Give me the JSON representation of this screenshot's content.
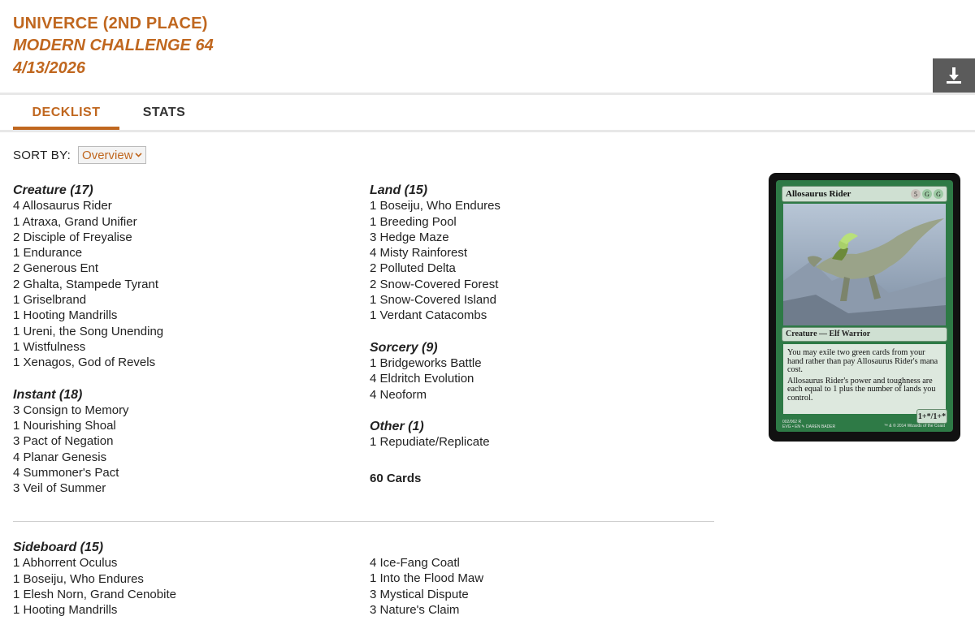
{
  "header": {
    "player": "UNIVERCE (2ND PLACE)",
    "event": "MODERN CHALLENGE 64",
    "date": "4/13/2026"
  },
  "tabs": [
    {
      "label": "DECKLIST",
      "active": true
    },
    {
      "label": "STATS",
      "active": false
    }
  ],
  "sort": {
    "label": "SORT BY:",
    "selected": "Overview"
  },
  "left_groups": [
    {
      "title": "Creature (17)",
      "cards": [
        "4 Allosaurus Rider",
        "1 Atraxa, Grand Unifier",
        "2 Disciple of Freyalise",
        "1 Endurance",
        "2 Generous Ent",
        "2 Ghalta, Stampede Tyrant",
        "1 Griselbrand",
        "1 Hooting Mandrills",
        "1 Ureni, the Song Unending",
        "1 Wistfulness",
        "1 Xenagos, God of Revels"
      ]
    },
    {
      "title": "Instant (18)",
      "cards": [
        "3 Consign to Memory",
        "1 Nourishing Shoal",
        "3 Pact of Negation",
        "4 Planar Genesis",
        "4 Summoner's Pact",
        "3 Veil of Summer"
      ]
    }
  ],
  "right_groups": [
    {
      "title": "Land (15)",
      "cards": [
        "1 Boseiju, Who Endures",
        "1 Breeding Pool",
        "3 Hedge Maze",
        "4 Misty Rainforest",
        "2 Polluted Delta",
        "2 Snow-Covered Forest",
        "1 Snow-Covered Island",
        "1 Verdant Catacombs"
      ]
    },
    {
      "title": "Sorcery (9)",
      "cards": [
        "1 Bridgeworks Battle",
        "4 Eldritch Evolution",
        "4 Neoform"
      ]
    },
    {
      "title": "Other (1)",
      "cards": [
        "1 Repudiate/Replicate"
      ]
    }
  ],
  "total": "60 Cards",
  "sideboard": {
    "title": "Sideboard (15)",
    "left": [
      "1 Abhorrent Oculus",
      "1 Boseiju, Who Endures",
      "1 Elesh Norn, Grand Cenobite",
      "1 Hooting Mandrills"
    ],
    "right": [
      "4 Ice-Fang Coatl",
      "1 Into the Flood Maw",
      "3 Mystical Dispute",
      "3 Nature's Claim"
    ]
  },
  "card_preview": {
    "name": "Allosaurus Rider",
    "mana": [
      "5",
      "G",
      "G"
    ],
    "type": "Creature — Elf Warrior",
    "text": [
      "You may exile two green cards from your hand rather than pay Allosaurus Rider's mana cost.",
      "Allosaurus Rider's power and toughness are each equal to 1 plus the number of lands you control."
    ],
    "pt": "1+*/1+*",
    "footer": "002/062 R",
    "footer2": "EVG • EN ✎ DAREN BADER",
    "copyright": "™ & © 2014 Wizards of the Coast"
  },
  "colors": {
    "accent": "#c0671f",
    "download_bg": "#5b5b5b"
  },
  "icons": {
    "download": "download-icon",
    "dropdown": "chevron-down-icon"
  }
}
